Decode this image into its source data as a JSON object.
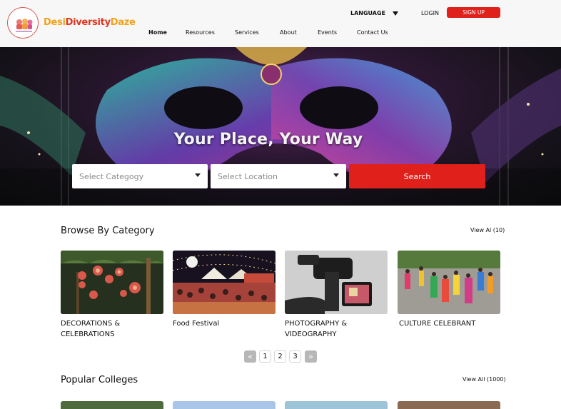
{
  "header": {
    "logo": {
      "part1": "Desi",
      "part2": "Diversity",
      "part3": "Daze"
    },
    "language_label": "LANGUAGE",
    "login_label": "LOGIN",
    "signup_label": "SIGN UP",
    "nav": [
      {
        "label": "Home",
        "active": true
      },
      {
        "label": "Resources"
      },
      {
        "label": "Services"
      },
      {
        "label": "About"
      },
      {
        "label": "Events"
      },
      {
        "label": "Contact Us"
      }
    ]
  },
  "hero": {
    "title": "Your Place, Your Way",
    "category_placeholder": "Select Categogy",
    "location_placeholder": "Select Location",
    "search_label": "Search"
  },
  "browse": {
    "title": "Browse By Category",
    "view_all": "View Al (10)",
    "cards": [
      {
        "label_line1": "DECORATIONS &",
        "label_line2": "CELEBRATIONS"
      },
      {
        "label_line1": "Food Festival",
        "label_line2": ""
      },
      {
        "label_line1": "PHOTOGRAPHY &",
        "label_line2": "VIDEOGRAPHY"
      },
      {
        "label_line1": "CULTURE CELEBRANT",
        "label_line2": ""
      }
    ]
  },
  "pagination": {
    "prev": "«",
    "pages": [
      "1",
      "2",
      "3"
    ],
    "next": "»"
  },
  "colleges": {
    "title": "Popular Colleges",
    "view_all": "View All (1000)"
  },
  "colors": {
    "accent": "#e0211b",
    "header_bg": "#f7f7f7",
    "logo_orange": "#f0a21b",
    "logo_red": "#e2351e"
  }
}
